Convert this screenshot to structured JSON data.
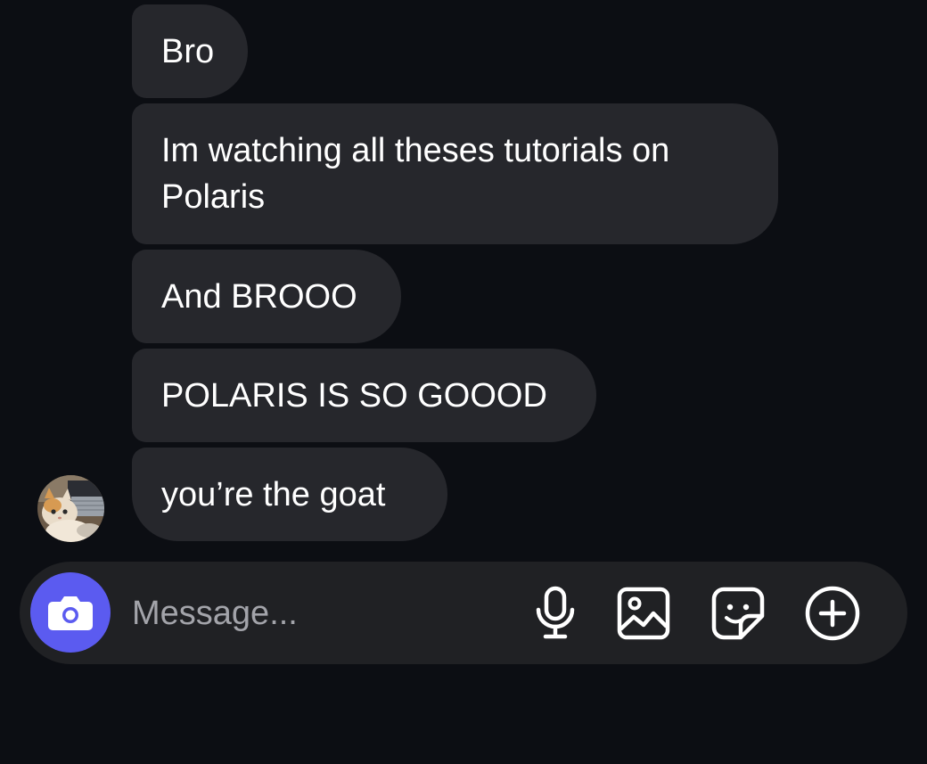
{
  "messages": [
    {
      "text": "Bro"
    },
    {
      "text": "Im watching all theses tutorials on Polaris"
    },
    {
      "text": "And BROOO"
    },
    {
      "text": "POLARIS IS SO GOOOD"
    },
    {
      "text": "you’re the goat"
    }
  ],
  "composer": {
    "placeholder": "Message...",
    "icons": [
      "camera-icon",
      "microphone-icon",
      "gallery-icon",
      "sticker-icon",
      "plus-circle-icon"
    ]
  },
  "colors": {
    "background": "#0c0e13",
    "bubble": "#26272c",
    "composer": "#202124",
    "camera_button": "#5b5bf0",
    "placeholder": "#a3a4aa"
  }
}
